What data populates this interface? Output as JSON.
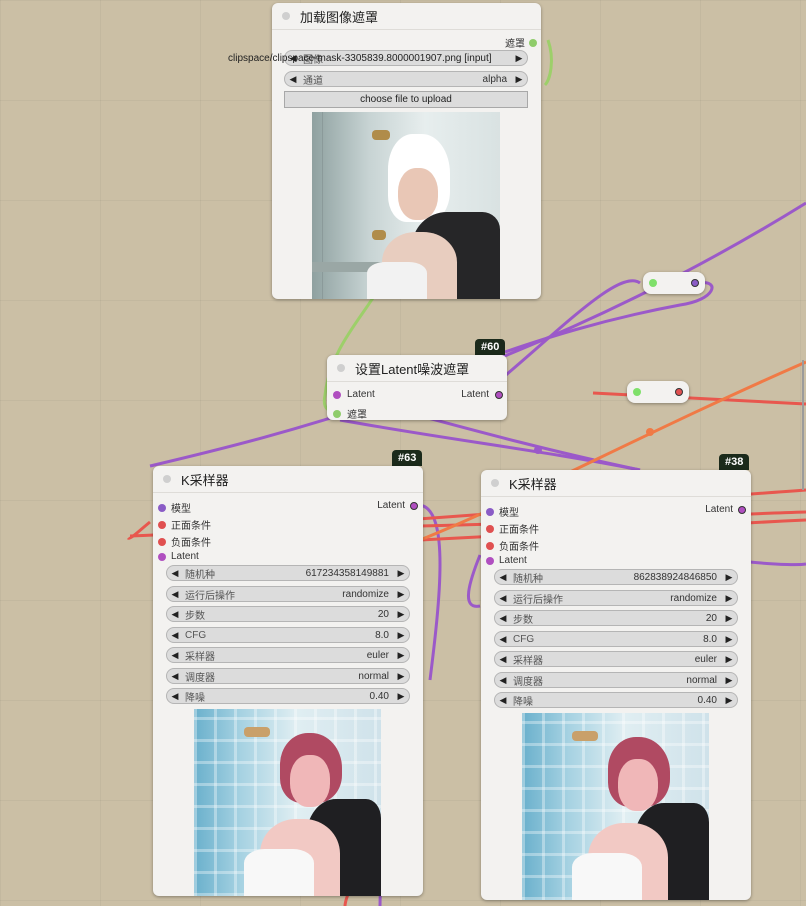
{
  "load_node": {
    "title": "加载图像遮罩",
    "output_label": "遮罩",
    "image_widget": {
      "label": "图像",
      "value": "clipspace/clipspace-mask-3305839.8000001907.png [input]"
    },
    "channel_widget": {
      "label": "通道",
      "value": "alpha"
    },
    "upload_label": "choose file to upload"
  },
  "latent_mask_node": {
    "badge": "#60",
    "title": "设置Latent噪波遮罩",
    "input_latent": "Latent",
    "input_mask": "遮罩",
    "output_latent": "Latent"
  },
  "ksampler_left": {
    "badge": "#63",
    "title": "K采样器",
    "inputs": [
      "模型",
      "正面条件",
      "负面条件",
      "Latent"
    ],
    "output": "Latent",
    "widgets": [
      {
        "label": "随机种",
        "value": "617234358149881"
      },
      {
        "label": "运行后操作",
        "value": "randomize"
      },
      {
        "label": "步数",
        "value": "20"
      },
      {
        "label": "CFG",
        "value": "8.0"
      },
      {
        "label": "采样器",
        "value": "euler"
      },
      {
        "label": "调度器",
        "value": "normal"
      },
      {
        "label": "降噪",
        "value": "0.40"
      }
    ]
  },
  "ksampler_right": {
    "badge": "#38",
    "title": "K采样器",
    "inputs": [
      "模型",
      "正面条件",
      "负面条件",
      "Latent"
    ],
    "output": "Latent",
    "widgets": [
      {
        "label": "随机种",
        "value": "862838924846850"
      },
      {
        "label": "运行后操作",
        "value": "randomize"
      },
      {
        "label": "步数",
        "value": "20"
      },
      {
        "label": "CFG",
        "value": "8.0"
      },
      {
        "label": "采样器",
        "value": "euler"
      },
      {
        "label": "调度器",
        "value": "normal"
      },
      {
        "label": "降噪",
        "value": "0.40"
      }
    ]
  },
  "colors": {
    "model_port": "#8a5cc6",
    "cond_port": "#e05050",
    "latent_port": "#b04fc0",
    "mask_port": "#8fcc6a",
    "wire_purple": "#9b59c9",
    "wire_red": "#e8574e",
    "wire_orange": "#f07a46",
    "wire_green": "#9dcf6a"
  },
  "icons": {
    "arrow_left": "◀",
    "arrow_right": "▶"
  }
}
